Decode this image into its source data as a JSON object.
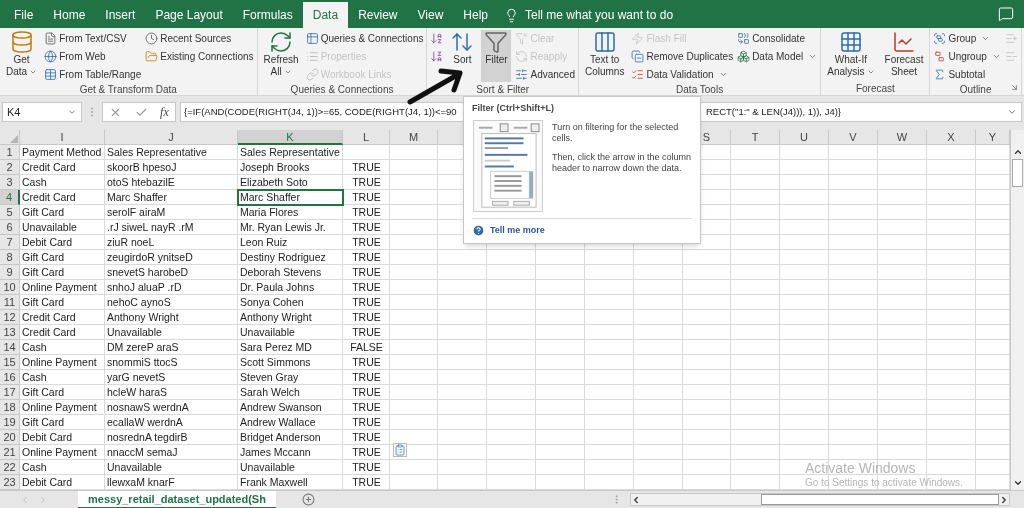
{
  "tabs": [
    {
      "label": "File",
      "selected": false
    },
    {
      "label": "Home",
      "selected": false
    },
    {
      "label": "Insert",
      "selected": false
    },
    {
      "label": "Page Layout",
      "selected": false
    },
    {
      "label": "Formulas",
      "selected": false
    },
    {
      "label": "Data",
      "selected": true
    },
    {
      "label": "Review",
      "selected": false
    },
    {
      "label": "View",
      "selected": false
    },
    {
      "label": "Help",
      "selected": false
    }
  ],
  "tell_me": {
    "placeholder": "Tell me what you want to do"
  },
  "ribbon_groups": [
    {
      "label": "Get & Transform Data",
      "items": [
        {
          "kind": "large",
          "label": "Get\nData",
          "dropdown": true
        },
        {
          "kind": "stack",
          "buttons": [
            {
              "label": "From Text/CSV",
              "disabled": false
            },
            {
              "label": "From Web",
              "disabled": false
            },
            {
              "label": "From Table/Range",
              "disabled": false
            }
          ]
        },
        {
          "kind": "stack",
          "buttons": [
            {
              "label": "Recent Sources",
              "disabled": false
            },
            {
              "label": "Existing Connections",
              "disabled": false
            }
          ]
        }
      ]
    },
    {
      "label": "Queries & Connections",
      "items": [
        {
          "kind": "large",
          "label": "Refresh\nAll",
          "dropdown": true
        },
        {
          "kind": "stack",
          "buttons": [
            {
              "label": "Queries & Connections",
              "disabled": false
            },
            {
              "label": "Properties",
              "disabled": true
            },
            {
              "label": "Workbook Links",
              "disabled": true
            }
          ]
        }
      ]
    },
    {
      "label": "Sort & Filter",
      "items": [
        {
          "kind": "stack",
          "buttons": [
            {
              "disabled": false
            },
            {
              "disabled": false
            }
          ]
        },
        {
          "kind": "large",
          "label": "Sort",
          "selected": false
        },
        {
          "kind": "large",
          "label": "Filter",
          "selected": true
        },
        {
          "kind": "stack",
          "buttons": [
            {
              "label": "Clear",
              "disabled": true
            },
            {
              "label": "Reapply",
              "disabled": true
            },
            {
              "label": "Advanced",
              "disabled": false
            }
          ]
        }
      ]
    },
    {
      "label": "Data Tools",
      "items": [
        {
          "kind": "large",
          "label": "Text to\nColumns"
        },
        {
          "kind": "stack",
          "buttons": [
            {
              "label": "Flash Fill",
              "disabled": true
            },
            {
              "label": "Remove Duplicates",
              "disabled": false
            },
            {
              "label": "Data Validation",
              "disabled": false,
              "dropdown": true
            }
          ]
        },
        {
          "kind": "stack",
          "buttons": [
            {
              "label": "Consolidate",
              "disabled": false
            },
            {
              "label": "Data Model",
              "disabled": false,
              "dropdown": true
            }
          ]
        }
      ]
    },
    {
      "label": "Forecast",
      "items": [
        {
          "kind": "large",
          "label": "What-If\nAnalysis",
          "dropdown": true
        },
        {
          "kind": "large",
          "label": "Forecast\nSheet"
        }
      ]
    },
    {
      "label": "Outline",
      "launcher": true,
      "items": [
        {
          "kind": "stack",
          "buttons": [
            {
              "label": "Group",
              "disabled": false,
              "dropdown": true
            },
            {
              "label": "Ungroup",
              "disabled": false,
              "dropdown": true
            },
            {
              "label": "Subtotal",
              "disabled": false
            }
          ]
        },
        {
          "kind": "stack",
          "buttons": [
            {
              "disabled": true
            },
            {
              "disabled": true
            }
          ]
        }
      ]
    }
  ],
  "formula_bar": {
    "name_box": "K4",
    "fx": "fx",
    "formula_start": "{=IF(AND(CODE(RIGHT(J4, 1))>=65, CODE(RIGHT(J4, 1))<=90",
    "formula_end": "RECT(\"1:\" & LEN(J4))), 1)), J4)}"
  },
  "columns_left": [
    {
      "letter": "I",
      "selected": false
    },
    {
      "letter": "J",
      "selected": false
    },
    {
      "letter": "K",
      "selected": true
    },
    {
      "letter": "L",
      "selected": false
    },
    {
      "letter": "M",
      "selected": false
    }
  ],
  "columns_right": [
    "S",
    "T",
    "U",
    "V",
    "W",
    "X",
    "Y"
  ],
  "rows": [
    {
      "num": "1",
      "selected": false,
      "cells": [
        "Payment Method",
        "Sales Representative",
        "Sales Representative"
      ]
    },
    {
      "num": "2",
      "selected": false,
      "cells": [
        "Credit Card",
        "skoorB hpesoJ",
        "Joseph Brooks",
        "TRUE"
      ]
    },
    {
      "num": "3",
      "selected": false,
      "cells": [
        "Cash",
        "otoS htebazilE",
        "Elizabeth Soto",
        "TRUE"
      ]
    },
    {
      "num": "4",
      "selected": true,
      "cells": [
        "Credit Card",
        "Marc Shaffer",
        "Marc Shaffer",
        "TRUE"
      ]
    },
    {
      "num": "5",
      "selected": false,
      "cells": [
        "Gift Card",
        "serolF airaM",
        "Maria Flores",
        "TRUE"
      ]
    },
    {
      "num": "6",
      "selected": false,
      "cells": [
        "Unavailable",
        ".rJ siweL nayR .rM",
        "Mr. Ryan Lewis Jr.",
        "TRUE"
      ]
    },
    {
      "num": "7",
      "selected": false,
      "cells": [
        "Debit Card",
        "ziuR noeL",
        "Leon Ruiz",
        "TRUE"
      ]
    },
    {
      "num": "8",
      "selected": false,
      "cells": [
        "Gift Card",
        "zeugirdoR ynitseD",
        "Destiny Rodriguez",
        "TRUE"
      ]
    },
    {
      "num": "9",
      "selected": false,
      "cells": [
        "Gift Card",
        "snevetS harobeD",
        "Deborah Stevens",
        "TRUE"
      ]
    },
    {
      "num": "10",
      "selected": false,
      "cells": [
        "Online Payment",
        "snhoJ aluaP .rD",
        "Dr. Paula Johns",
        "TRUE"
      ]
    },
    {
      "num": "11",
      "selected": false,
      "cells": [
        "Gift Card",
        "nehoC aynoS",
        "Sonya Cohen",
        "TRUE"
      ]
    },
    {
      "num": "12",
      "selected": false,
      "cells": [
        "Credit Card",
        "Anthony Wright",
        "Anthony Wright",
        "TRUE"
      ]
    },
    {
      "num": "13",
      "selected": false,
      "cells": [
        "Credit Card",
        "Unavailable",
        "Unavailable",
        "TRUE"
      ]
    },
    {
      "num": "14",
      "selected": false,
      "cells": [
        "Cash",
        "DM zereP araS",
        "Sara Perez MD",
        "FALSE"
      ]
    },
    {
      "num": "15",
      "selected": false,
      "cells": [
        "Online Payment",
        "snommiS ttocS",
        "Scott Simmons",
        "TRUE"
      ]
    },
    {
      "num": "16",
      "selected": false,
      "cells": [
        "Cash",
        "yarG nevetS",
        "Steven Gray",
        "TRUE"
      ]
    },
    {
      "num": "17",
      "selected": false,
      "cells": [
        "Gift Card",
        "hcleW haraS",
        "Sarah Welch",
        "TRUE"
      ]
    },
    {
      "num": "18",
      "selected": false,
      "cells": [
        "Online Payment",
        "nosnawS werdnA",
        "Andrew Swanson",
        "TRUE"
      ]
    },
    {
      "num": "19",
      "selected": false,
      "cells": [
        "Gift Card",
        "ecallaW werdnA",
        "Andrew Wallace",
        "TRUE"
      ]
    },
    {
      "num": "20",
      "selected": false,
      "cells": [
        "Debit Card",
        "nosrednA tegdirB",
        "Bridget Anderson",
        "TRUE"
      ]
    },
    {
      "num": "21",
      "selected": false,
      "cells": [
        "Online Payment",
        "nnaccM semaJ",
        "James Mccann",
        "TRUE"
      ]
    },
    {
      "num": "22",
      "selected": false,
      "cells": [
        "Cash",
        "Unavailable",
        "Unavailable",
        "TRUE"
      ]
    },
    {
      "num": "23",
      "selected": false,
      "cells": [
        "Debit Card",
        "llewxaM knarF",
        "Frank Maxwell",
        "TRUE"
      ]
    }
  ],
  "tooltip": {
    "title": "Filter (Ctrl+Shift+L)",
    "text_1": "Turn on filtering for the selected cells.",
    "text_2": "Then, click the arrow in the column header to narrow down the data.",
    "link": "Tell me more"
  },
  "sheet_tabs": [
    {
      "label": "messy_retail_dataset_updated(Sh",
      "selected": true
    }
  ],
  "activation_notice": {
    "title": "Activate Windows",
    "text": "Go to Settings to activate Windows."
  }
}
